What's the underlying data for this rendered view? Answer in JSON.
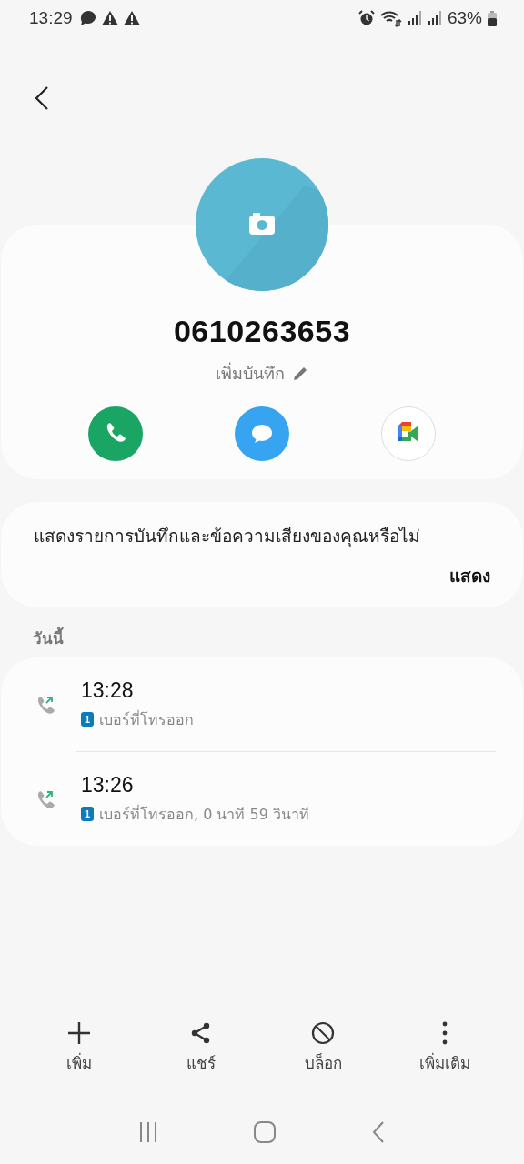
{
  "status_bar": {
    "time": "13:29",
    "battery": "63%"
  },
  "contact": {
    "number": "0610263653",
    "note_link": "เพิ่มบันทึก"
  },
  "actions": [
    {
      "kind": "call"
    },
    {
      "kind": "message"
    },
    {
      "kind": "video"
    }
  ],
  "prompt": {
    "text": "แสดงรายการบันทึกและข้อความเสียงของคุณหรือไม่",
    "button": "แสดง"
  },
  "section_label": "วันนี้",
  "calls": [
    {
      "time": "13:28",
      "sim": "1",
      "detail": "เบอร์ที่โทรออก"
    },
    {
      "time": "13:26",
      "sim": "1",
      "detail": "เบอร์ที่โทรออก, 0 นาที 59 วินาที"
    }
  ],
  "toolbar": [
    {
      "kind": "add",
      "label": "เพิ่ม"
    },
    {
      "kind": "share",
      "label": "แชร์"
    },
    {
      "kind": "block",
      "label": "บล็อก"
    },
    {
      "kind": "more",
      "label": "เพิ่มเติม"
    }
  ]
}
